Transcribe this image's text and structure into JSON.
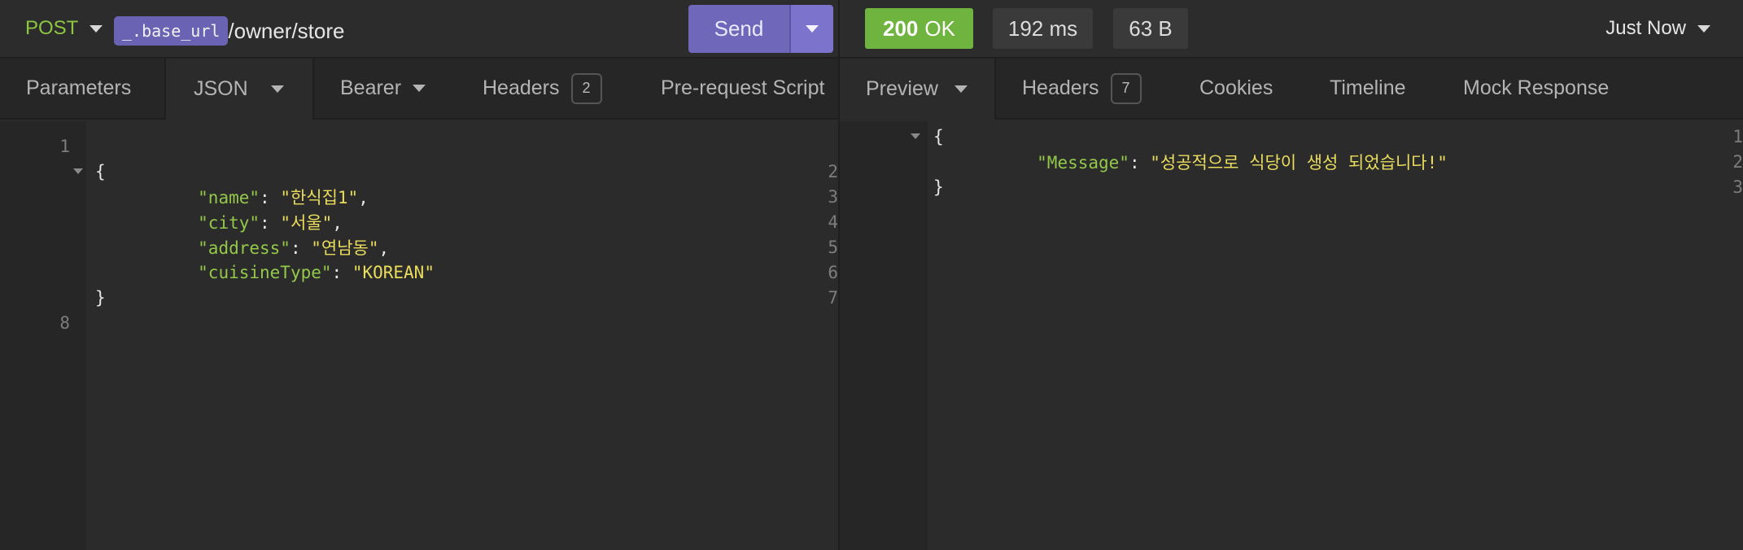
{
  "request": {
    "method": "POST",
    "url_variable": "_.base_url",
    "url_path": "/owner/store",
    "send_label": "Send",
    "tabs": [
      {
        "label": "Parameters"
      },
      {
        "label": "JSON"
      },
      {
        "label": "Bearer"
      },
      {
        "label": "Headers",
        "count": "2"
      },
      {
        "label": "Pre-request Script"
      }
    ],
    "body_lines": [
      {
        "n": "1"
      },
      {
        "n": "2",
        "punct": "{"
      },
      {
        "n": "3",
        "key": "\"name\"",
        "value": "\"한식집1\"",
        "trail": ","
      },
      {
        "n": "4",
        "key": "\"city\"",
        "value": "\"서울\"",
        "trail": ","
      },
      {
        "n": "5",
        "key": "\"address\"",
        "value": "\"연남동\"",
        "trail": ","
      },
      {
        "n": "6",
        "key": "\"cuisineType\"",
        "value": "\"KOREAN\"",
        "trail": ""
      },
      {
        "n": "7",
        "punct": "}"
      },
      {
        "n": "8"
      }
    ]
  },
  "response": {
    "status_code": "200",
    "status_text": "OK",
    "time": "192 ms",
    "size": "63 B",
    "history_label": "Just Now",
    "tabs": [
      {
        "label": "Preview"
      },
      {
        "label": "Headers",
        "count": "7"
      },
      {
        "label": "Cookies"
      },
      {
        "label": "Timeline"
      },
      {
        "label": "Mock Response"
      }
    ],
    "body_lines": [
      {
        "n": "1",
        "punct": "{"
      },
      {
        "n": "2",
        "key": "\"Message\"",
        "value": "\"성공적으로 식당이 생성 되었습니다!\"",
        "trail": ""
      },
      {
        "n": "3",
        "punct": "}"
      }
    ]
  },
  "colors": {
    "method": "#8dc641",
    "status_ok": "#6fb43f",
    "send": "#6f67b9",
    "json_key": "#93c84a",
    "json_string": "#eadc5d"
  }
}
